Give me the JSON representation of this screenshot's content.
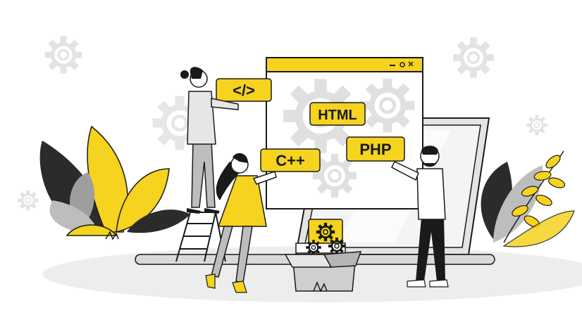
{
  "tags": {
    "code": "</>",
    "html": "HTML",
    "cpp": "C++",
    "php": "PHP"
  },
  "colors": {
    "accent": "#f5d31f",
    "dark": "#1a1a1a",
    "gray": "#bdbdbd",
    "light_gray": "#e9e9e9",
    "ground": "#ececec"
  },
  "icons": [
    "gear-icon",
    "window-minimize-icon",
    "window-maximize-icon",
    "window-close-icon",
    "leaf-icon",
    "ladder-icon",
    "box-icon"
  ]
}
